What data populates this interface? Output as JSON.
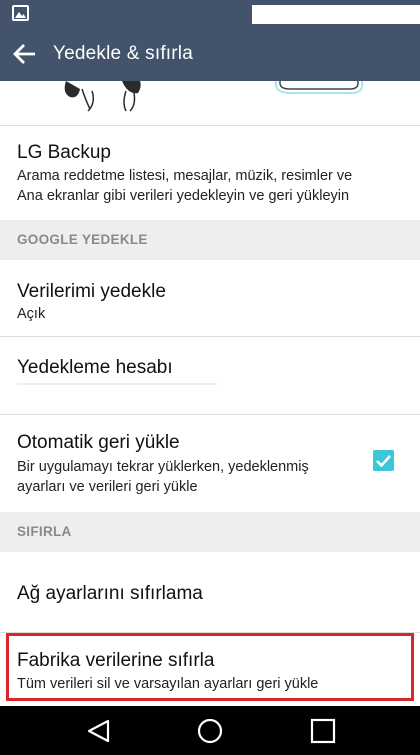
{
  "app_bar": {
    "title": "Yedekle & sıfırla"
  },
  "items": {
    "lg_backup": {
      "title": "LG Backup",
      "subtitle": "Arama reddetme listesi, mesajlar, müzik, resimler ve Ana ekranlar gibi verileri yedekleyin ve geri yükleyin"
    },
    "backup_my_data": {
      "title": "Verilerimi yedekle",
      "subtitle": "Açık"
    },
    "backup_account": {
      "title": "Yedekleme hesabı"
    },
    "auto_restore": {
      "title": "Otomatik geri yükle",
      "subtitle": "Bir uygulamayı tekrar yüklerken, yedeklenmiş ayarları ve verileri geri yükle",
      "checked": true
    },
    "network_reset": {
      "title": "Ağ ayarlarını sıfırlama"
    },
    "factory_reset": {
      "title": "Fabrika verilerine sıfırla",
      "subtitle": "Tüm verileri sil ve varsayılan ayarları geri yükle"
    }
  },
  "sections": {
    "google_backup": "GOOGLE YEDEKLE",
    "reset": "SIFIRLA"
  },
  "colors": {
    "app_bar": "#42536b",
    "checkbox": "#3cc7d6",
    "highlight": "#d8262f",
    "section_bg": "#eeeeee"
  },
  "icons": {
    "status": "image-icon",
    "back": "back-arrow-icon",
    "checkbox": "check-icon",
    "nav": [
      "back-triangle-icon",
      "home-circle-icon",
      "recents-square-icon"
    ]
  }
}
